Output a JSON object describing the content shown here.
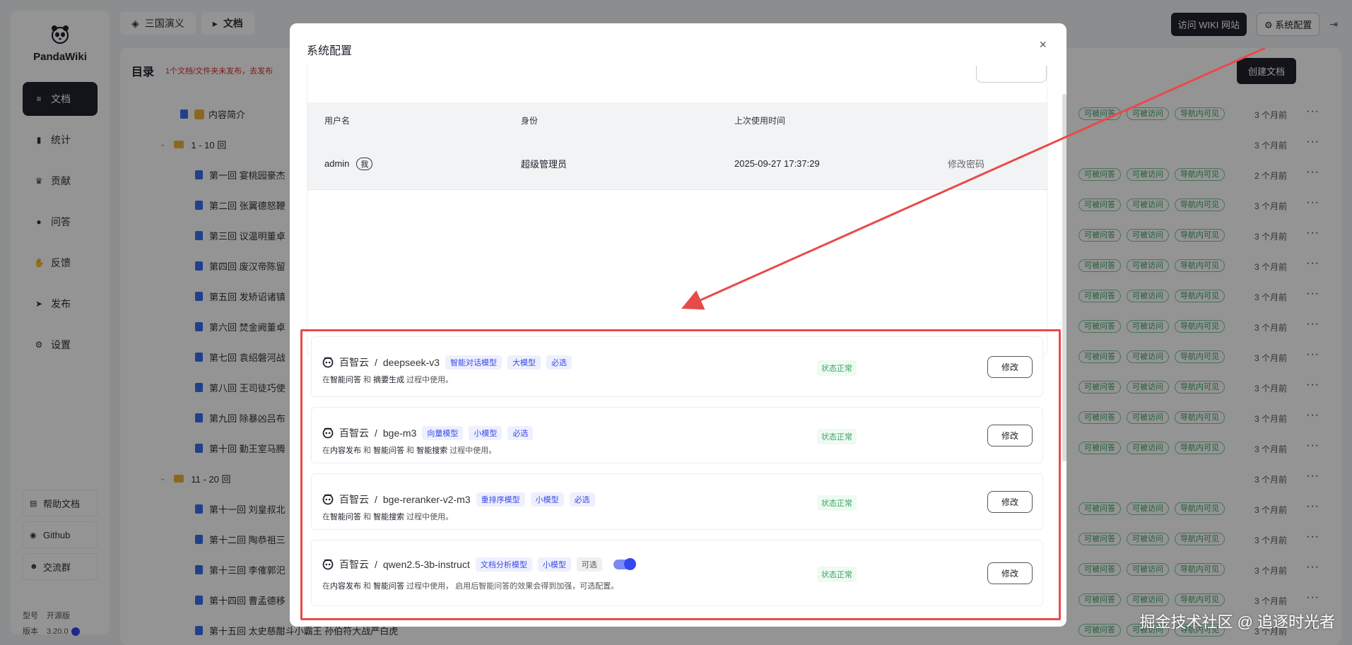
{
  "app": {
    "name": "PandaWiki"
  },
  "sidebar": {
    "items": [
      {
        "label": "文档",
        "icon": "layers-icon",
        "active": true
      },
      {
        "label": "统计",
        "icon": "bar-chart-icon"
      },
      {
        "label": "贡献",
        "icon": "trophy-icon"
      },
      {
        "label": "问答",
        "icon": "chat-icon"
      },
      {
        "label": "反馈",
        "icon": "hand-icon"
      },
      {
        "label": "发布",
        "icon": "send-icon"
      },
      {
        "label": "设置",
        "icon": "gear-icon"
      }
    ],
    "links": [
      {
        "label": "帮助文档",
        "icon": "doc-icon"
      },
      {
        "label": "Github",
        "icon": "github-icon"
      },
      {
        "label": "交流群",
        "icon": "group-icon"
      }
    ],
    "model_label": "型号",
    "model_value": "开源版",
    "version_label": "版本",
    "version_value": "3.20.0"
  },
  "header": {
    "breadcrumb": [
      "三国演义",
      "文档"
    ],
    "visit_wiki": "访问 WIKI 网站",
    "system_config": "系统配置"
  },
  "main": {
    "title": "目录",
    "notice": "1个文档/文件夹未发布，去发布",
    "create_button": "创建文档",
    "rows": [
      {
        "type": "doc",
        "label": "内容简介",
        "indent": 1,
        "time": "3 个月前",
        "tags": true,
        "emoji": true
      },
      {
        "type": "folder",
        "label": "1 - 10 回",
        "indent": 0,
        "time": "3 个月前",
        "tags": false
      },
      {
        "type": "doc",
        "label": "第一回 宴桃园豪杰",
        "indent": 2,
        "time": "2 个月前",
        "tags": true
      },
      {
        "type": "doc",
        "label": "第二回 张翼德怒鞭",
        "indent": 2,
        "time": "3 个月前",
        "tags": true
      },
      {
        "type": "doc",
        "label": "第三回 议温明董卓",
        "indent": 2,
        "time": "3 个月前",
        "tags": true
      },
      {
        "type": "doc",
        "label": "第四回 废汉帝陈留",
        "indent": 2,
        "time": "3 个月前",
        "tags": true
      },
      {
        "type": "doc",
        "label": "第五回 发矫诏诸镇",
        "indent": 2,
        "time": "3 个月前",
        "tags": true
      },
      {
        "type": "doc",
        "label": "第六回 焚金阙董卓",
        "indent": 2,
        "time": "3 个月前",
        "tags": true
      },
      {
        "type": "doc",
        "label": "第七回 袁绍磐河战",
        "indent": 2,
        "time": "3 个月前",
        "tags": true
      },
      {
        "type": "doc",
        "label": "第八回 王司徒巧使",
        "indent": 2,
        "time": "3 个月前",
        "tags": true
      },
      {
        "type": "doc",
        "label": "第九回 除暴凶吕布",
        "indent": 2,
        "time": "3 个月前",
        "tags": true
      },
      {
        "type": "doc",
        "label": "第十回 勤王室马腾",
        "indent": 2,
        "time": "3 个月前",
        "tags": true
      },
      {
        "type": "folder",
        "label": "11 - 20 回",
        "indent": 0,
        "time": "3 个月前",
        "tags": false
      },
      {
        "type": "doc",
        "label": "第十一回 刘皇叔北",
        "indent": 2,
        "time": "3 个月前",
        "tags": true
      },
      {
        "type": "doc",
        "label": "第十二回 陶恭祖三",
        "indent": 2,
        "time": "3 个月前",
        "tags": true
      },
      {
        "type": "doc",
        "label": "第十三回 李傕郭汜",
        "indent": 2,
        "time": "3 个月前",
        "tags": true
      },
      {
        "type": "doc",
        "label": "第十四回 曹孟德移",
        "indent": 2,
        "time": "3 个月前",
        "tags": true
      },
      {
        "type": "doc",
        "label": "第十五回 太史慈酣斗小霸王 孙伯符大战严白虎",
        "indent": 2,
        "time": "3 个月前",
        "tags": true
      }
    ],
    "tag_labels": [
      "可被问答",
      "可被访问",
      "导航内可见"
    ]
  },
  "modal": {
    "title": "系统配置",
    "close": "×",
    "user_table": {
      "headers": [
        "用户名",
        "身份",
        "上次使用时间",
        ""
      ],
      "rows": [
        {
          "username": "admin",
          "me": "我",
          "role": "超级管理员",
          "last_used": "2025-09-27 17:37:29",
          "action": "修改密码"
        }
      ]
    },
    "models": [
      {
        "provider": "百智云",
        "name": "deepseek-v3",
        "tags": [
          "智能对话模型",
          "大模型",
          "必选"
        ],
        "desc_parts": [
          "在",
          "智能问答",
          " 和 ",
          "摘要生成",
          " 过程中使用。"
        ],
        "status": "状态正常",
        "edit": "修改"
      },
      {
        "provider": "百智云",
        "name": "bge-m3",
        "tags": [
          "向量模型",
          "小模型",
          "必选"
        ],
        "desc_parts": [
          "在",
          "内容发布",
          " 和 ",
          "智能问答",
          " 和 ",
          "智能搜索",
          " 过程中使用。"
        ],
        "status": "状态正常",
        "edit": "修改"
      },
      {
        "provider": "百智云",
        "name": "bge-reranker-v2-m3",
        "tags": [
          "重排序模型",
          "小模型",
          "必选"
        ],
        "desc_parts": [
          "在",
          "智能问答",
          " 和 ",
          "智能搜索",
          " 过程中使用。"
        ],
        "status": "状态正常",
        "edit": "修改"
      },
      {
        "provider": "百智云",
        "name": "qwen2.5-3b-instruct",
        "tags": [
          "文档分析模型",
          "小模型"
        ],
        "optional_tag": "可选",
        "toggle_on": true,
        "desc_parts": [
          "在",
          "内容发布",
          " 和 ",
          "智能问答",
          " 过程中使用， 启用后智能问答的效果会得到加强，可选配置。"
        ],
        "status": "状态正常",
        "edit": "修改"
      }
    ]
  },
  "watermark": "掘金技术社区 @ 追逐时光者",
  "colors": {
    "accent": "#3248f2",
    "dark": "#21222d",
    "annotation": "#e84a4a",
    "ok": "#3aa364"
  }
}
